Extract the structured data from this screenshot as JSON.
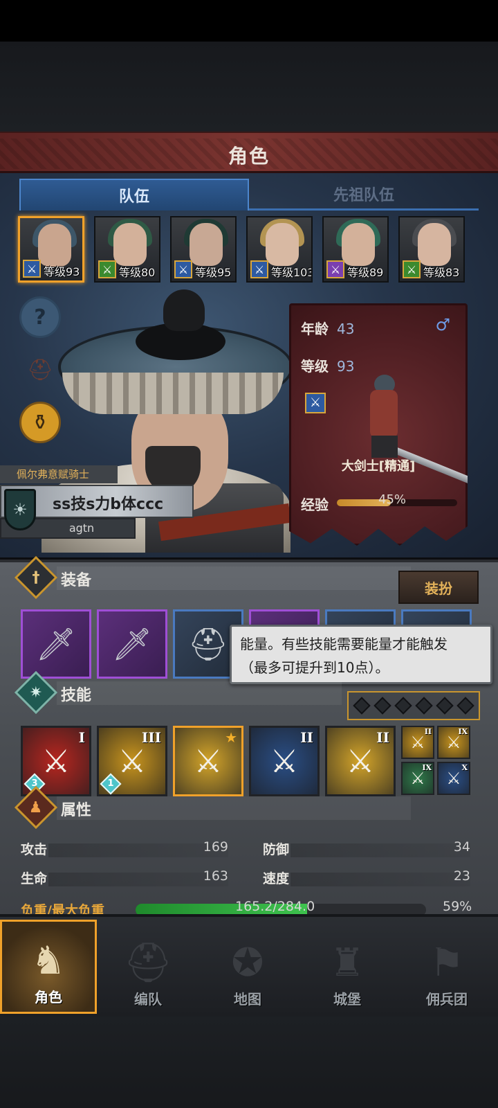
{
  "header": {
    "title": "角色"
  },
  "tabs": [
    {
      "label": "队伍",
      "active": true
    },
    {
      "label": "先祖队伍",
      "active": false
    }
  ],
  "roster": [
    {
      "level_text": "等级93",
      "hair": "#3d5668",
      "skin": "#c9a58e",
      "badge_color": "#2d5aa1",
      "badge_icon": "sword-icon"
    },
    {
      "level_text": "等级80",
      "hair": "#2f5a45",
      "skin": "#d3b19a",
      "badge_color": "#3b8a2e",
      "badge_icon": "sword-icon"
    },
    {
      "level_text": "等级95",
      "hair": "#1f3a34",
      "skin": "#c8a894",
      "badge_color": "#2d5aa1",
      "badge_icon": "sword-icon"
    },
    {
      "level_text": "等级103",
      "hair": "#b39452",
      "skin": "#d8b9a3",
      "badge_color": "#2d5aa1",
      "badge_icon": "sword-icon"
    },
    {
      "level_text": "等级89",
      "hair": "#2f6a57",
      "skin": "#d3b19a",
      "badge_color": "#7a3fb0",
      "badge_icon": "staff-icon"
    },
    {
      "level_text": "等级83",
      "hair": "#4a4c50",
      "skin": "#d6b5a0",
      "badge_color": "#3b8a2e",
      "badge_icon": "sword-icon"
    }
  ],
  "hero": {
    "title": "佩尔弗意赋骑士",
    "name": "ss技s力b体ccc",
    "sub": "agtn",
    "age_label": "年龄",
    "age": "43",
    "level_label": "等级",
    "level": "93",
    "gender_symbol": "♂",
    "class_name": "大剑士[精通]",
    "exp_label": "经验",
    "exp_pct_text": "45%",
    "exp_fraction": 0.45
  },
  "equipment": {
    "title": "装备",
    "dress_button": "装扮",
    "slots": [
      {
        "icon": "greatsword-icon",
        "rarity": "epic"
      },
      {
        "icon": "greatsword-icon",
        "rarity": "epic"
      },
      {
        "icon": "helmet-icon",
        "rarity": "rare"
      },
      {
        "icon": "armor-icon",
        "rarity": "epic"
      },
      {
        "icon": "gloves-icon",
        "rarity": "rare"
      },
      {
        "icon": "boots-icon",
        "rarity": "rare"
      }
    ]
  },
  "tooltip": {
    "line1": "能量。有些技能需要能量才能触发",
    "line2": "（最多可提升到10点）。"
  },
  "skills": {
    "title": "技能",
    "energy_pips": 6,
    "main": [
      {
        "rank": "I",
        "bg": "#b8261f",
        "icon": "cleave-icon",
        "count": "3"
      },
      {
        "rank": "III",
        "bg": "#c9951e",
        "icon": "crossed-swords-icon",
        "count": "1"
      },
      {
        "rank": "★",
        "bg": "#d4a52a",
        "icon": "summon-swords-icon"
      },
      {
        "rank": "II",
        "bg": "#2a4e85",
        "icon": "crystal-sword-icon"
      },
      {
        "rank": "II",
        "bg": "#d4a52a",
        "icon": "burst-sword-icon"
      }
    ],
    "passive": [
      {
        "rank": "II",
        "bg": "#c9951e",
        "icon": "shield-break-icon"
      },
      {
        "rank": "IX",
        "bg": "#c9951e",
        "icon": "double-sword-icon"
      },
      {
        "rank": "IX",
        "bg": "#2f7a4a",
        "icon": "burst-icon"
      },
      {
        "rank": "X",
        "bg": "#2a4e85",
        "icon": "twin-blades-icon"
      }
    ]
  },
  "attributes": {
    "title": "属性",
    "attack_label": "攻击",
    "attack": "169",
    "defense_label": "防御",
    "defense": "34",
    "hp_label": "生命",
    "hp": "163",
    "speed_label": "速度",
    "speed": "23",
    "load_label": "负重/最大负重",
    "load_text": "165.2/284.0",
    "load_pct_text": "59%",
    "load_fraction": 0.59
  },
  "nav": [
    {
      "label": "角色",
      "icon": "knight-icon",
      "active": true
    },
    {
      "label": "编队",
      "icon": "helmet-group-icon",
      "active": false
    },
    {
      "label": "地图",
      "icon": "compass-icon",
      "active": false
    },
    {
      "label": "城堡",
      "icon": "castle-icon",
      "active": false
    },
    {
      "label": "佣兵团",
      "icon": "banner-icon",
      "active": false
    }
  ]
}
